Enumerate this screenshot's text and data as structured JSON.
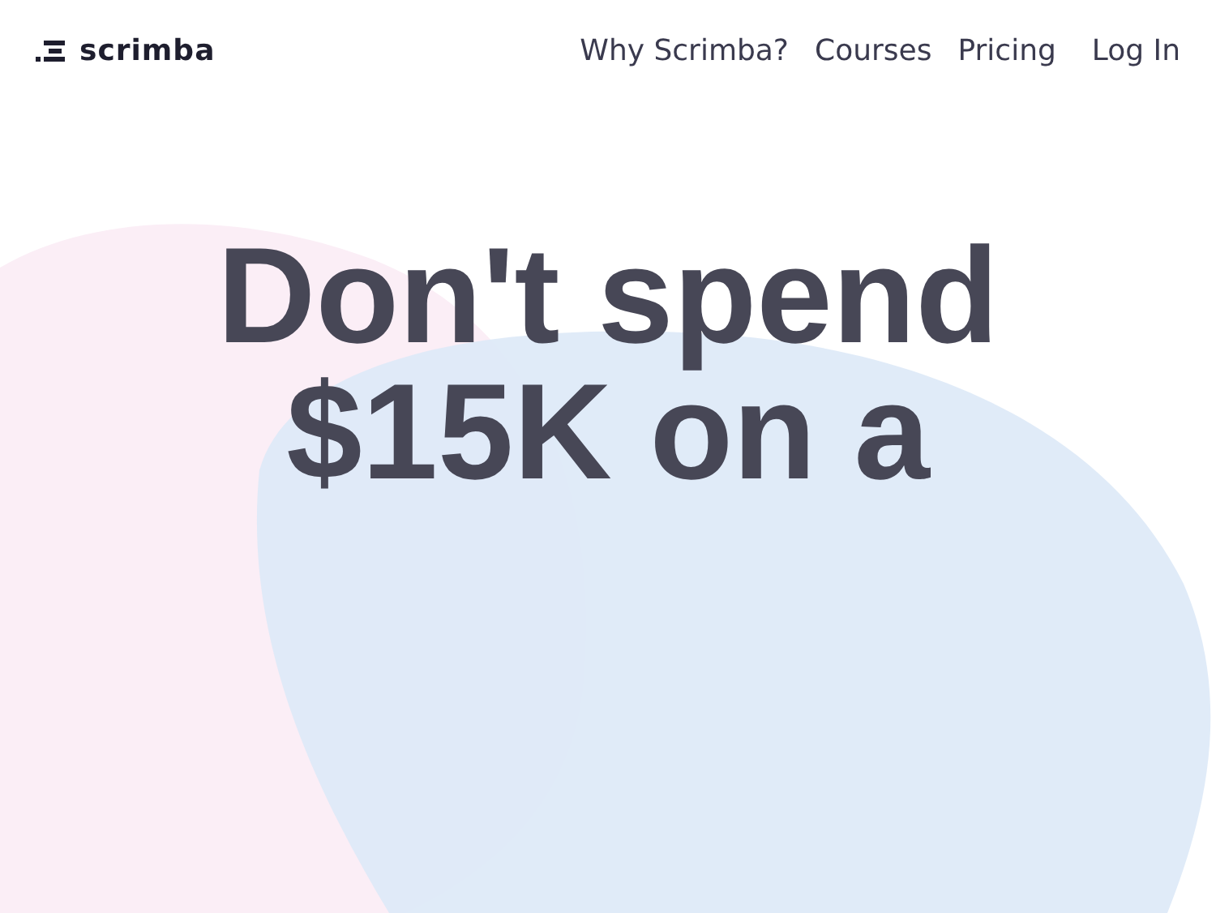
{
  "header": {
    "logo_text": "scrimba",
    "nav": [
      {
        "label": "Why Scrimba?"
      },
      {
        "label": "Courses"
      },
      {
        "label": "Pricing"
      },
      {
        "label": "Log In"
      }
    ]
  },
  "hero": {
    "heading": "Don't spend $15K on a"
  }
}
